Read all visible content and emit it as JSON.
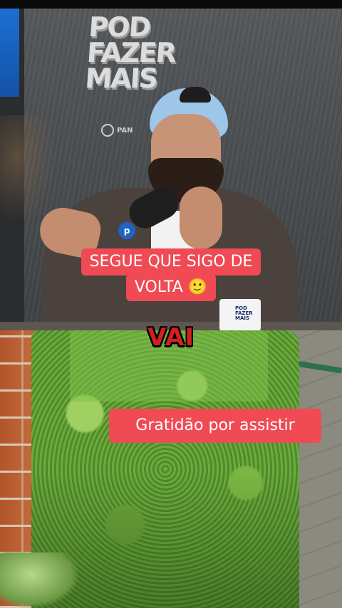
{
  "video": {
    "top_panel": {
      "studio_logo_lines": [
        "POD",
        "FAZER",
        "MAIS"
      ],
      "studio_logo_sub": "PAN",
      "mic_badge": "p",
      "mug_text": [
        "POD",
        "FAZER",
        "MAIS"
      ]
    },
    "captions": {
      "main_line1": "SEGUE QUE SIGO DE",
      "main_line2": "VOLTA 🙂",
      "vai": "VAI",
      "thanks": "Gratidão por assistir"
    }
  },
  "colors": {
    "caption_bg": "#f04a55",
    "caption_text": "#ffffff",
    "vai_text": "#d4201c"
  }
}
